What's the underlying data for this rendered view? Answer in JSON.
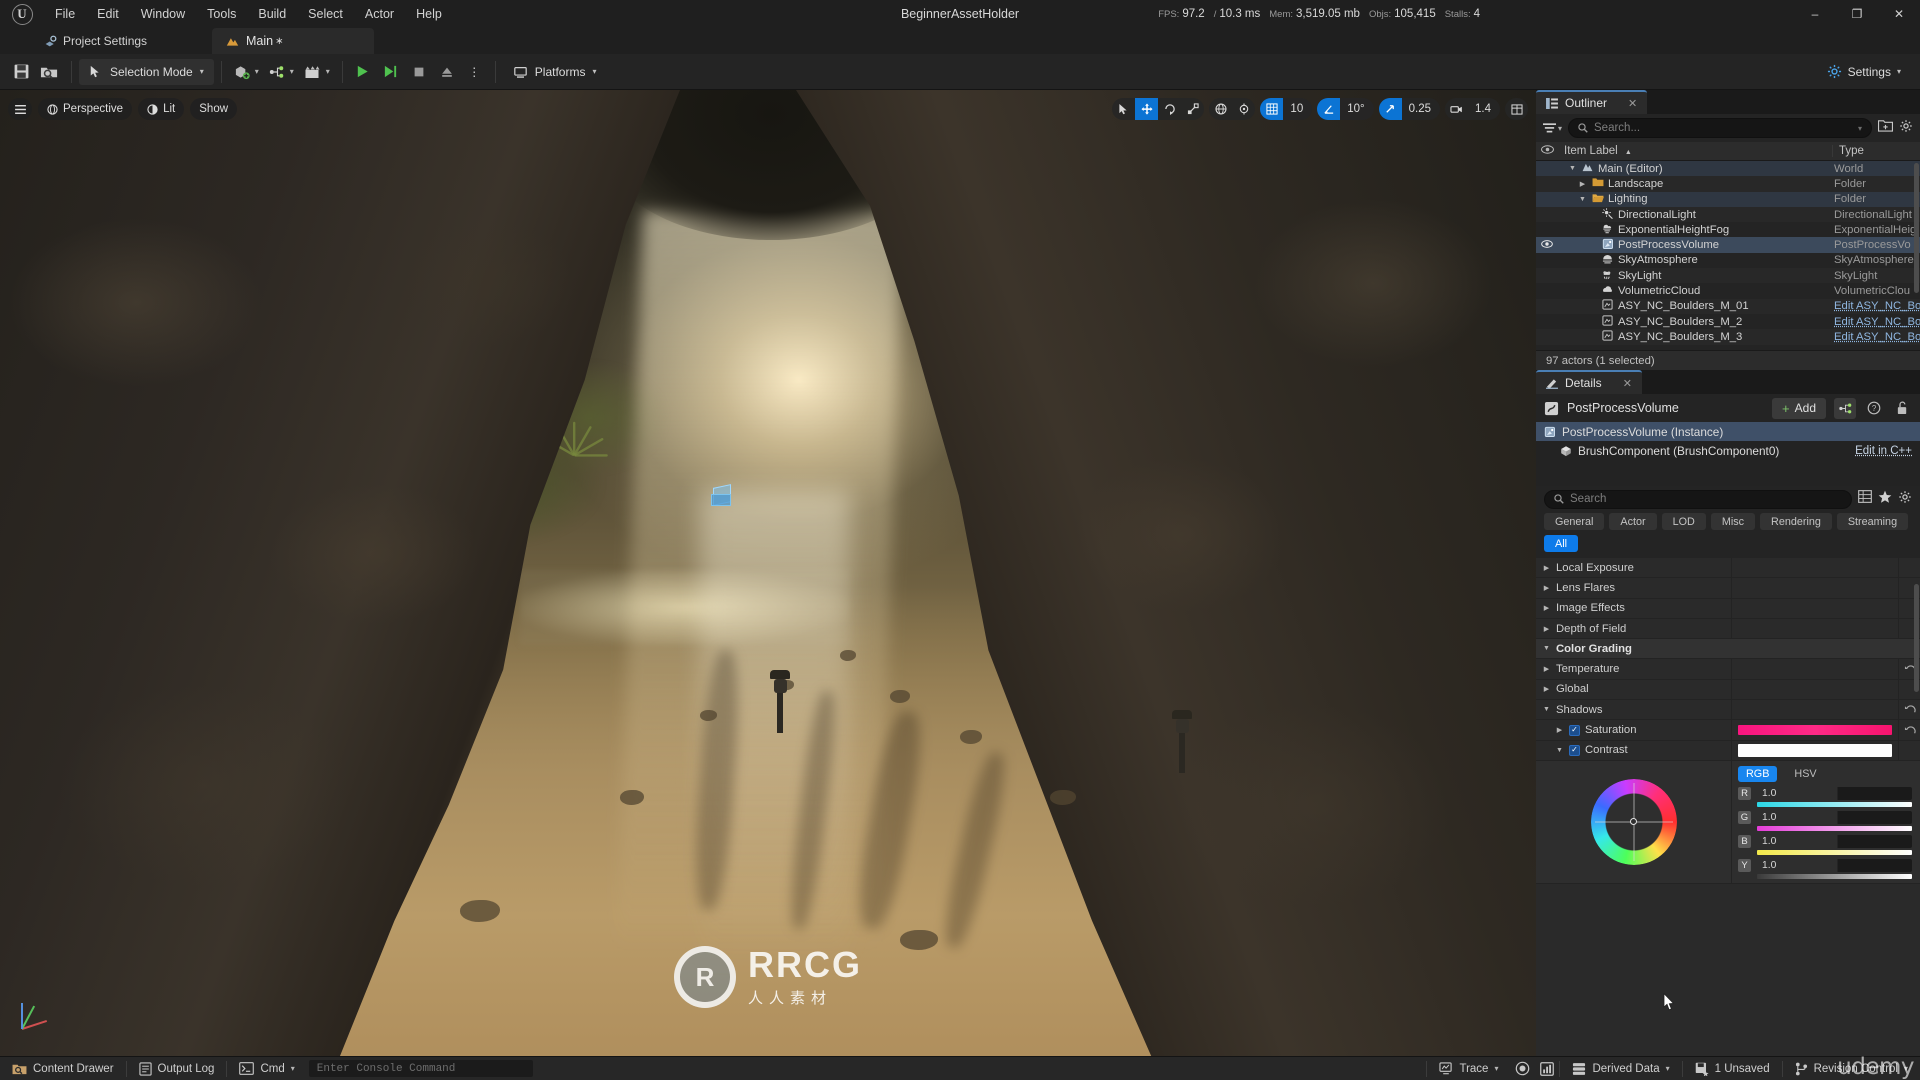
{
  "titlebar": {
    "logo": "ue-logo",
    "menus": [
      "File",
      "Edit",
      "Window",
      "Tools",
      "Build",
      "Select",
      "Actor",
      "Help"
    ],
    "stats": [
      {
        "label": "FPS:",
        "value": "97.2"
      },
      {
        "label": "/",
        "value": "10.3 ms"
      },
      {
        "label": "Mem:",
        "value": "3,519.05 mb"
      },
      {
        "label": "Objs:",
        "value": "105,415"
      },
      {
        "label": "Stalls:",
        "value": "4"
      }
    ],
    "window_title": "BeginnerAssetHolder",
    "minimize": "–",
    "maximize": "❐",
    "close": "✕"
  },
  "tabrow": {
    "project_settings": "Project Settings",
    "level_tab": "Main",
    "level_tab_dirty": "∗"
  },
  "toolbar": {
    "save_label": "save-icon",
    "browse_label": "browse-icon",
    "selection_mode": "Selection Mode",
    "platforms": "Platforms",
    "settings": "Settings"
  },
  "viewport": {
    "perspective": "Perspective",
    "lit": "Lit",
    "show": "Show",
    "grid_snap": "10",
    "angle_snap": "10°",
    "scale_snap": "0.25",
    "camera_speed": "1.4"
  },
  "outliner": {
    "tab_title": "Outliner",
    "close": "✕",
    "search_placeholder": "Search...",
    "columns": {
      "item_label": "Item Label",
      "type": "Type",
      "sort_arrow": "▲"
    },
    "footer": "97 actors (1 selected)",
    "rows": [
      {
        "label": "Main (Editor)",
        "type": "World",
        "indent": 1,
        "tri": "▼",
        "icon": "world-icon",
        "state": "hl",
        "eye": false,
        "link": false
      },
      {
        "label": "Landscape",
        "type": "Folder",
        "indent": 2,
        "tri": "▶",
        "icon": "folder-icon",
        "state": "",
        "eye": false,
        "link": false
      },
      {
        "label": "Lighting",
        "type": "Folder",
        "indent": 2,
        "tri": "▼",
        "icon": "folder-open-icon",
        "state": "hl",
        "eye": false,
        "link": false
      },
      {
        "label": "DirectionalLight",
        "type": "DirectionalLight",
        "indent": 3,
        "tri": "",
        "icon": "directional-light-icon",
        "state": "",
        "eye": false,
        "link": false
      },
      {
        "label": "ExponentialHeightFog",
        "type": "ExponentialHeig",
        "indent": 3,
        "tri": "",
        "icon": "fog-icon",
        "state": "",
        "eye": false,
        "link": false
      },
      {
        "label": "PostProcessVolume",
        "type": "PostProcessVo",
        "indent": 3,
        "tri": "",
        "icon": "volume-icon",
        "state": "sel",
        "eye": true,
        "link": false
      },
      {
        "label": "SkyAtmosphere",
        "type": "SkyAtmosphere",
        "indent": 3,
        "tri": "",
        "icon": "sky-atmosphere-icon",
        "state": "",
        "eye": false,
        "link": false
      },
      {
        "label": "SkyLight",
        "type": "SkyLight",
        "indent": 3,
        "tri": "",
        "icon": "sky-light-icon",
        "state": "",
        "eye": false,
        "link": false
      },
      {
        "label": "VolumetricCloud",
        "type": "VolumetricClou",
        "indent": 3,
        "tri": "",
        "icon": "cloud-icon",
        "state": "",
        "eye": false,
        "link": false
      },
      {
        "label": "ASY_NC_Boulders_M_01",
        "type": "Edit ASY_NC_Bo",
        "indent": 3,
        "tri": "",
        "icon": "static-mesh-icon",
        "state": "",
        "eye": false,
        "link": true
      },
      {
        "label": "ASY_NC_Boulders_M_2",
        "type": "Edit ASY_NC_Bo",
        "indent": 3,
        "tri": "",
        "icon": "static-mesh-icon",
        "state": "",
        "eye": false,
        "link": true
      },
      {
        "label": "ASY_NC_Boulders_M_3",
        "type": "Edit ASY_NC_Bo",
        "indent": 3,
        "tri": "",
        "icon": "static-mesh-icon",
        "state": "",
        "eye": false,
        "link": true
      }
    ]
  },
  "details": {
    "tab_title": "Details",
    "close": "✕",
    "actor_name": "PostProcessVolume",
    "add_label": "Add",
    "components": [
      {
        "label": "PostProcessVolume (Instance)",
        "icon": "volume-icon",
        "selected": true,
        "action": ""
      },
      {
        "label": "BrushComponent (BrushComponent0)",
        "icon": "brush-icon",
        "selected": false,
        "action": "Edit in C++"
      }
    ],
    "search_placeholder": "Search",
    "filters": [
      {
        "label": "General",
        "active": false
      },
      {
        "label": "Actor",
        "active": false
      },
      {
        "label": "LOD",
        "active": false
      },
      {
        "label": "Misc",
        "active": false
      },
      {
        "label": "Rendering",
        "active": false
      },
      {
        "label": "Streaming",
        "active": false
      },
      {
        "label": "All",
        "active": true
      }
    ],
    "properties": [
      {
        "label": "Local Exposure",
        "tri": "▶",
        "kind": "section",
        "indent": 0,
        "reset": false
      },
      {
        "label": "Lens Flares",
        "tri": "▶",
        "kind": "section",
        "indent": 0,
        "reset": false
      },
      {
        "label": "Image Effects",
        "tri": "▶",
        "kind": "section",
        "indent": 0,
        "reset": false
      },
      {
        "label": "Depth of Field",
        "tri": "▶",
        "kind": "section",
        "indent": 0,
        "reset": false
      },
      {
        "label": "Color Grading",
        "tri": "▼",
        "kind": "category",
        "indent": 0,
        "reset": false
      },
      {
        "label": "Temperature",
        "tri": "▶",
        "kind": "section",
        "indent": 0,
        "reset": true
      },
      {
        "label": "Global",
        "tri": "▶",
        "kind": "section",
        "indent": 0,
        "reset": false
      },
      {
        "label": "Shadows",
        "tri": "▼",
        "kind": "section",
        "indent": 0,
        "reset": true
      },
      {
        "label": "Saturation",
        "tri": "▶",
        "kind": "prop",
        "indent": 1,
        "checkbox": true,
        "swatch": "pink",
        "reset": true
      },
      {
        "label": "Contrast",
        "tri": "▼",
        "kind": "prop",
        "indent": 1,
        "checkbox": true,
        "swatch": "white",
        "reset": false
      }
    ],
    "color_picker": {
      "mode_rgb": "RGB",
      "mode_hsv": "HSV",
      "channels": [
        {
          "key": "R",
          "value": "1.0"
        },
        {
          "key": "G",
          "value": "1.0"
        },
        {
          "key": "B",
          "value": "1.0"
        },
        {
          "key": "Y",
          "value": "1.0"
        }
      ]
    }
  },
  "statusbar": {
    "content_drawer": "Content Drawer",
    "output_log": "Output Log",
    "cmd": "Cmd",
    "console_placeholder": "Enter Console Command",
    "trace": "Trace",
    "derived_data": "Derived Data",
    "unsaved": "1 Unsaved",
    "revision_control": "Revision Control"
  },
  "watermark": {
    "logo_letter": "R",
    "brand": "RRCG",
    "sub": "人人素材",
    "corner": "udemy"
  }
}
